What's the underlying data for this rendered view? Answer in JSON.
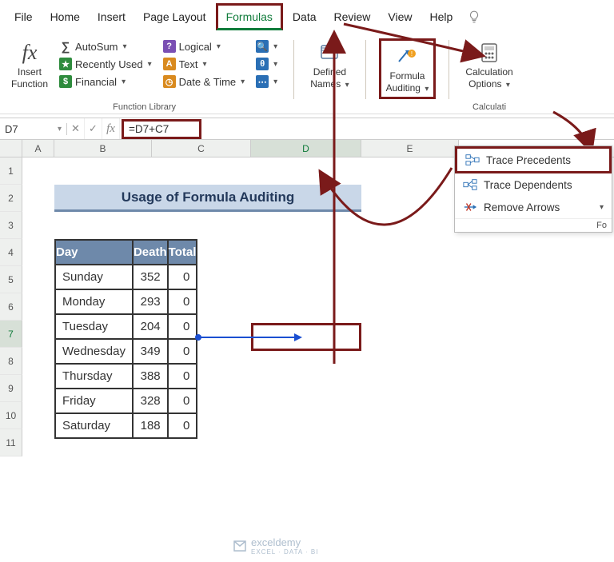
{
  "menu": {
    "file": "File",
    "home": "Home",
    "insert": "Insert",
    "page_layout": "Page Layout",
    "formulas": "Formulas",
    "data": "Data",
    "review": "Review",
    "view": "View",
    "help": "Help"
  },
  "ribbon": {
    "insert_function_line1": "Insert",
    "insert_function_line2": "Function",
    "autosum": "AutoSum",
    "recently_used": "Recently Used",
    "financial": "Financial",
    "logical": "Logical",
    "text": "Text",
    "date_time": "Date & Time",
    "function_library_label": "Function Library",
    "defined_names_line1": "Defined",
    "defined_names_line2": "Names",
    "formula_auditing_line1": "Formula",
    "formula_auditing_line2": "Auditing",
    "calculation_options_line1": "Calculation",
    "calculation_options_line2": "Options",
    "calculation_label": "Calculati"
  },
  "dropdown": {
    "trace_precedents": "Trace Precedents",
    "trace_dependents": "Trace Dependents",
    "remove_arrows": "Remove Arrows",
    "footer": "Fo"
  },
  "formula_bar": {
    "name_box": "D7",
    "formula": "=D7+C7"
  },
  "columns": {
    "A": "A",
    "B": "B",
    "C": "C",
    "D": "D",
    "E": "E"
  },
  "sheet": {
    "title": "Usage of Formula Auditing",
    "headers": {
      "day": "Day",
      "death": "Death",
      "total": "Total"
    },
    "rows": [
      {
        "day": "Sunday",
        "death": "352",
        "total": "0"
      },
      {
        "day": "Monday",
        "death": "293",
        "total": "0"
      },
      {
        "day": "Tuesday",
        "death": "204",
        "total": "0"
      },
      {
        "day": "Wednesday",
        "death": "349",
        "total": "0"
      },
      {
        "day": "Thursday",
        "death": "388",
        "total": "0"
      },
      {
        "day": "Friday",
        "death": "328",
        "total": "0"
      },
      {
        "day": "Saturday",
        "death": "188",
        "total": "0"
      }
    ]
  },
  "watermark": {
    "brand": "exceldemy",
    "tagline": "EXCEL · DATA · BI"
  },
  "colors": {
    "highlight_border": "#7a1a1a",
    "active_tab_underline": "#0f7b3a",
    "table_header_bg": "#6e89aa",
    "trace_arrow": "#1b4fd1"
  }
}
